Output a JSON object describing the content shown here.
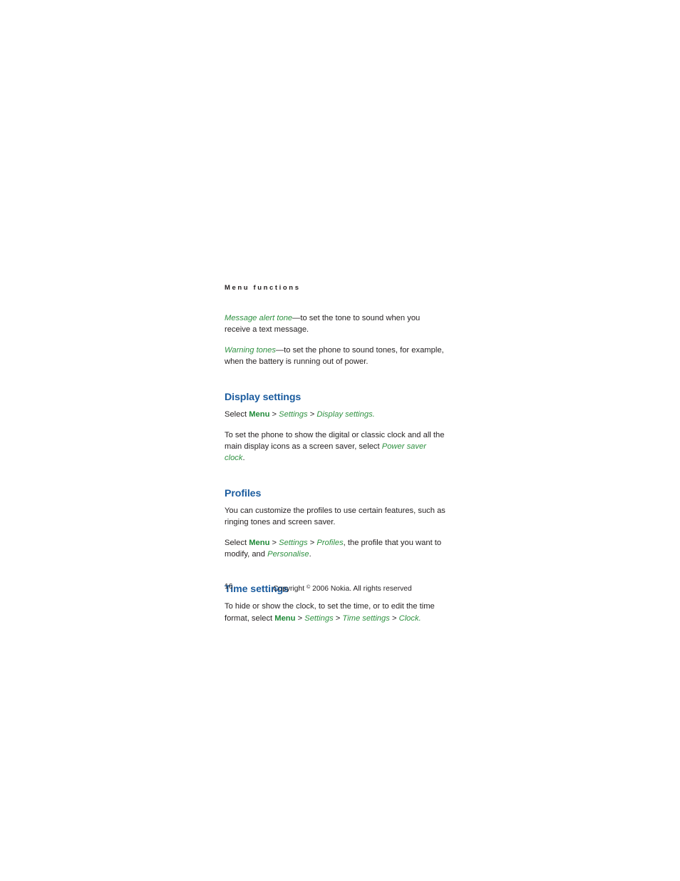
{
  "document": {
    "running_head": "Menu functions",
    "page_number": "16",
    "copyright": {
      "prefix": "Copyright ",
      "symbol": "©",
      "suffix": " 2006 Nokia. All rights reserved"
    }
  },
  "colors": {
    "heading_blue": "#1a5b9e",
    "ui_term_green": "#2f9141",
    "body_black": "#231f20",
    "page_background": "#ffffff"
  },
  "intro_paragraphs": [
    {
      "term": "Message alert tone",
      "rest": "—to set the tone to sound when you receive a text message."
    },
    {
      "term": "Warning tones",
      "rest": "—to set the phone to sound tones, for example, when the battery is running out of power."
    }
  ],
  "sections": [
    {
      "heading": "Display settings",
      "paragraphs": [
        {
          "kind": "path",
          "lead": "Select ",
          "menu": "Menu",
          "sep1": " > ",
          "item1": "Settings",
          "sep2": " > ",
          "item2": "Display settings",
          "tail": "."
        },
        {
          "kind": "mixed",
          "lead": "To set the phone to show the digital or classic clock and all the main display icons as a screen saver, select ",
          "term": "Power saver clock",
          "tail": "."
        }
      ]
    },
    {
      "heading": "Profiles",
      "paragraphs": [
        {
          "kind": "plain",
          "text": "You can customize the profiles to use certain features, such as ringing tones and screen saver."
        },
        {
          "kind": "path2",
          "lead": "Select ",
          "menu": "Menu",
          "sep1": " > ",
          "item1": "Settings",
          "sep2": " > ",
          "item2": "Profiles",
          "mid": ", the profile that you want to modify, and ",
          "item3": "Personalise",
          "tail": "."
        }
      ]
    },
    {
      "heading": "Time settings",
      "paragraphs": [
        {
          "kind": "path3",
          "lead": "To hide or show the clock, to set the time, or to edit the time format, select ",
          "menu": "Menu",
          "sep1": " > ",
          "item1": "Settings",
          "sep2": " > ",
          "item2": "Time settings",
          "sep3": " > ",
          "item3": "Clock",
          "tail": "."
        }
      ]
    }
  ]
}
